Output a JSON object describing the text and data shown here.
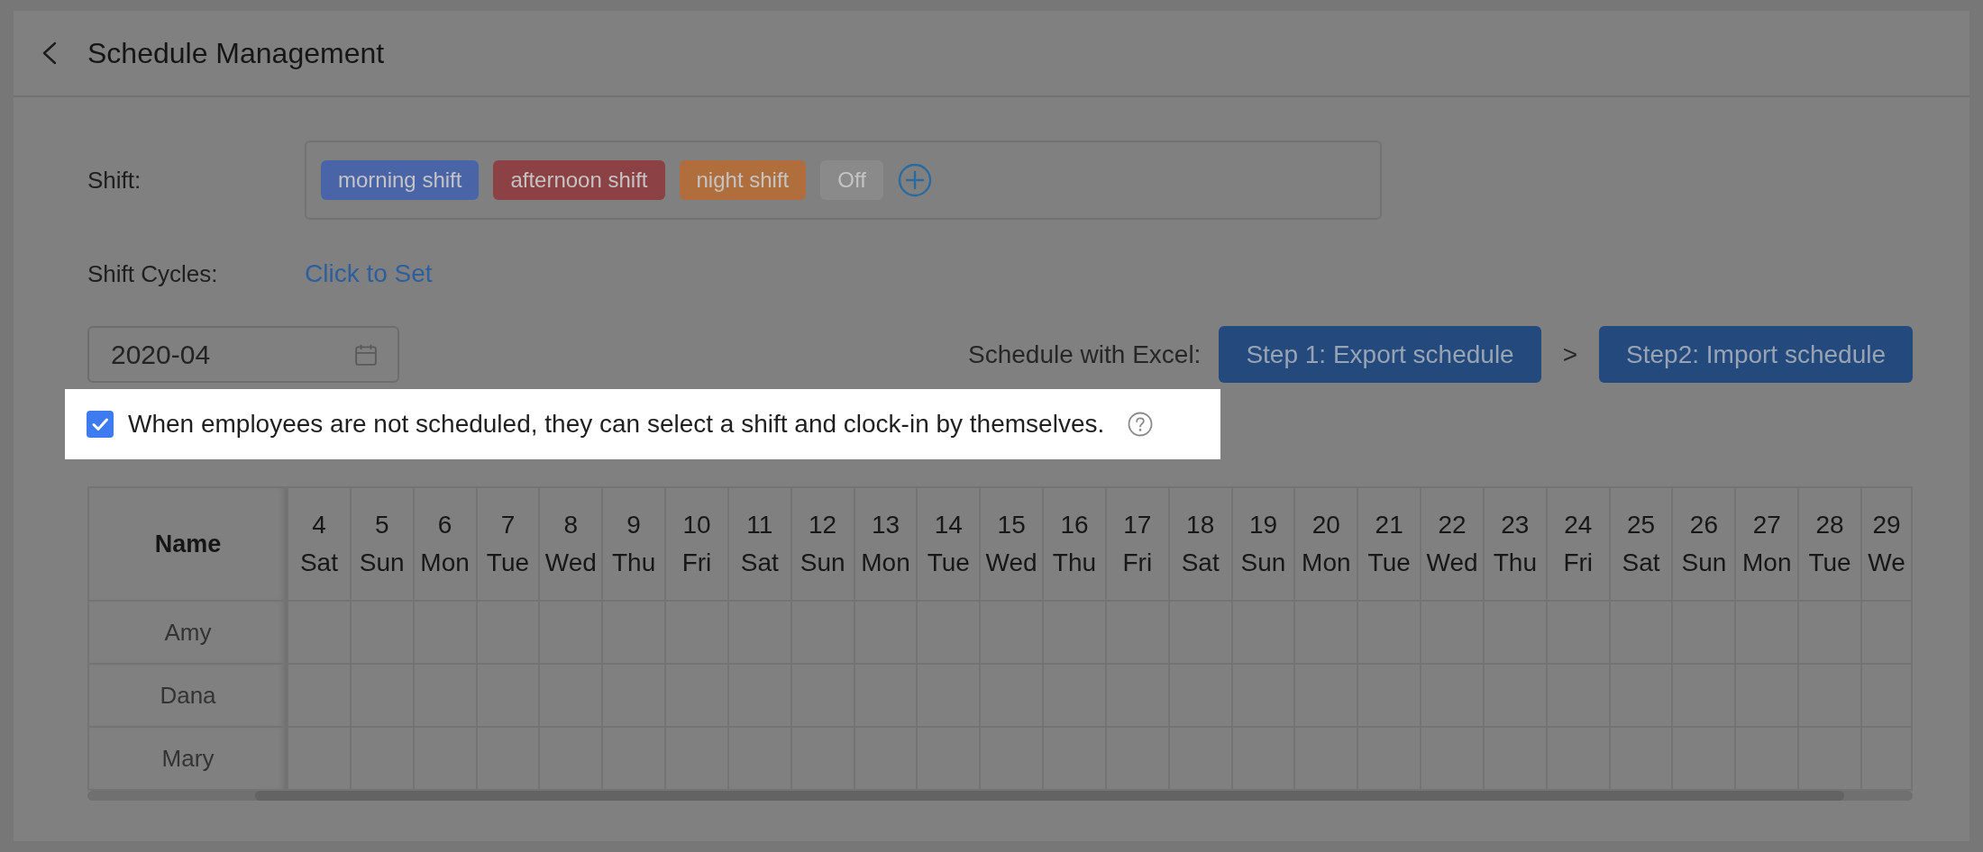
{
  "header": {
    "title": "Schedule Management"
  },
  "shift": {
    "label": "Shift:",
    "tags": [
      {
        "text": "morning shift",
        "color": "#4a64a8"
      },
      {
        "text": "afternoon shift",
        "color": "#8c4144"
      },
      {
        "text": "night shift",
        "color": "#b06e3c"
      },
      {
        "text": "Off",
        "color": "#8a8a8a"
      }
    ]
  },
  "shift_cycles": {
    "label": "Shift Cycles:",
    "link": "Click to Set"
  },
  "month_picker": {
    "value": "2020-04"
  },
  "excel_schedule": {
    "label": "Schedule with Excel:",
    "steps": [
      {
        "text": "Step 1: Export schedule"
      },
      {
        "text": "Step2: Import schedule"
      }
    ],
    "separator": ">"
  },
  "self_select_option": {
    "checked": true,
    "highlighted": true,
    "text": "When employees are not scheduled, they can select a shift and clock-in by themselves."
  },
  "schedule_table": {
    "name_header": "Name",
    "days": [
      {
        "date": "4",
        "weekday": "Sat"
      },
      {
        "date": "5",
        "weekday": "Sun"
      },
      {
        "date": "6",
        "weekday": "Mon"
      },
      {
        "date": "7",
        "weekday": "Tue"
      },
      {
        "date": "8",
        "weekday": "Wed"
      },
      {
        "date": "9",
        "weekday": "Thu"
      },
      {
        "date": "10",
        "weekday": "Fri"
      },
      {
        "date": "11",
        "weekday": "Sat"
      },
      {
        "date": "12",
        "weekday": "Sun"
      },
      {
        "date": "13",
        "weekday": "Mon"
      },
      {
        "date": "14",
        "weekday": "Tue"
      },
      {
        "date": "15",
        "weekday": "Wed"
      },
      {
        "date": "16",
        "weekday": "Thu"
      },
      {
        "date": "17",
        "weekday": "Fri"
      },
      {
        "date": "18",
        "weekday": "Sat"
      },
      {
        "date": "19",
        "weekday": "Sun"
      },
      {
        "date": "20",
        "weekday": "Mon"
      },
      {
        "date": "21",
        "weekday": "Tue"
      },
      {
        "date": "22",
        "weekday": "Wed"
      },
      {
        "date": "23",
        "weekday": "Thu"
      },
      {
        "date": "24",
        "weekday": "Fri"
      },
      {
        "date": "25",
        "weekday": "Sat"
      },
      {
        "date": "26",
        "weekday": "Sun"
      },
      {
        "date": "27",
        "weekday": "Mon"
      },
      {
        "date": "28",
        "weekday": "Tue"
      },
      {
        "date": "29",
        "weekday": "We"
      }
    ],
    "employees": [
      "Amy",
      "Dana",
      "Mary"
    ]
  }
}
